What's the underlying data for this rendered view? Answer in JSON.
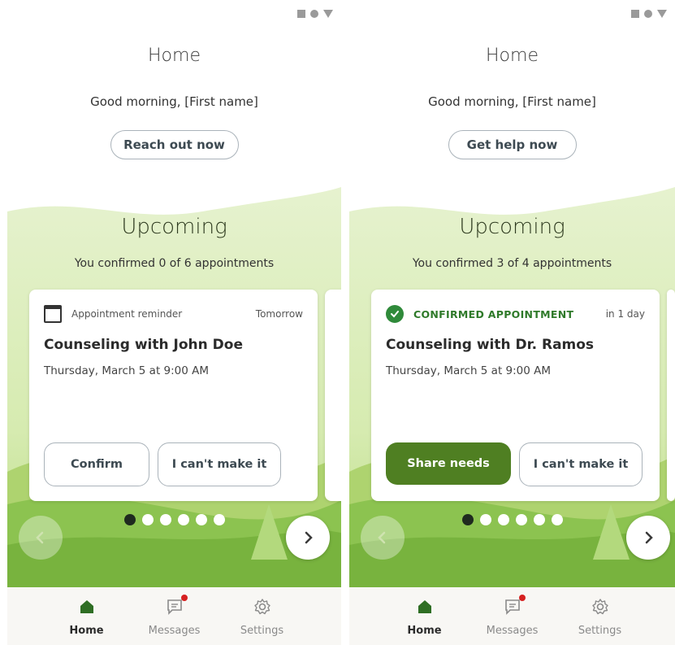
{
  "colors": {
    "brand_green": "#4f7f22",
    "confirm_green": "#2f7a2a",
    "badge_red": "#d62020",
    "hill_light": "#d8ecb4",
    "hill_dark": "#8cc350"
  },
  "screens": [
    {
      "title": "Home",
      "greeting": "Good morning, [First name]",
      "help_button": "Reach out now",
      "section_title": "Upcoming",
      "summary": "You confirmed 0 of 6 appointments",
      "card": {
        "icon": "calendar-icon",
        "label": "Appointment reminder",
        "time": "Tomorrow",
        "title": "Counseling with John Doe",
        "datetime": "Thursday, March 5 at 9:00 AM",
        "primary_action": "Confirm",
        "secondary_action": "I can't make it"
      },
      "page_count": 6,
      "active_page": 1
    },
    {
      "title": "Home",
      "greeting": "Good morning, [First name]",
      "help_button": "Get help now",
      "section_title": "Upcoming",
      "summary": "You confirmed 3 of 4 appointments",
      "card": {
        "icon": "check-circle-icon",
        "label": "CONFIRMED APPOINTMENT",
        "time": "in 1 day",
        "title": "Counseling with Dr. Ramos",
        "datetime": "Thursday, March 5 at 9:00 AM",
        "primary_action": "Share needs",
        "secondary_action": "I can't make it"
      },
      "page_count": 6,
      "active_page": 1
    }
  ],
  "tabbar": {
    "home": "Home",
    "messages": "Messages",
    "settings": "Settings"
  }
}
